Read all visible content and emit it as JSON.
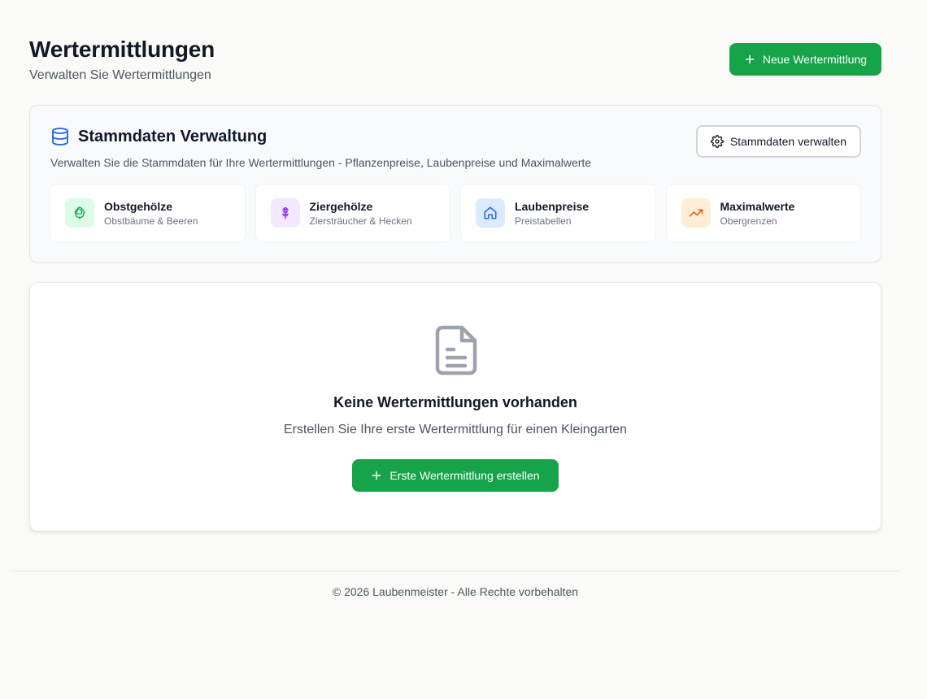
{
  "header": {
    "title": "Wertermittlungen",
    "subtitle": "Verwalten Sie Wertermittlungen",
    "new_button_label": "Neue Wertermittlung"
  },
  "master_data": {
    "title": "Stammdaten Verwaltung",
    "description": "Verwalten Sie die Stammdaten für Ihre Wertermittlungen - Pflanzenpreise, Laubenpreise und Maximalwerte",
    "manage_button_label": "Stammdaten verwalten",
    "tiles": [
      {
        "title": "Obstgehölze",
        "subtitle": "Obstbäume & Beeren",
        "icon": "tree-icon",
        "color": "#16a34a",
        "bg": "#dcfce7"
      },
      {
        "title": "Ziergehölze",
        "subtitle": "Ziersträucher & Hecken",
        "icon": "flower-icon",
        "color": "#9333ea",
        "bg": "#f3e8ff"
      },
      {
        "title": "Laubenpreise",
        "subtitle": "Preistabellen",
        "icon": "house-icon",
        "color": "#2563eb",
        "bg": "#dbeafe"
      },
      {
        "title": "Maximalwerte",
        "subtitle": "Obergrenzen",
        "icon": "trending-up-icon",
        "color": "#ea580c",
        "bg": "#ffedd5"
      }
    ]
  },
  "empty_state": {
    "title": "Keine Wertermittlungen vorhanden",
    "subtitle": "Erstellen Sie Ihre erste Wertermittlung für einen Kleingarten",
    "button_label": "Erste Wertermittlung erstellen"
  },
  "footer": {
    "text": "© 2026 Laubenmeister - Alle Rechte vorbehalten"
  },
  "colors": {
    "primary": "#16a34a",
    "database_icon": "#2563eb",
    "empty_icon": "#9ca3af"
  }
}
